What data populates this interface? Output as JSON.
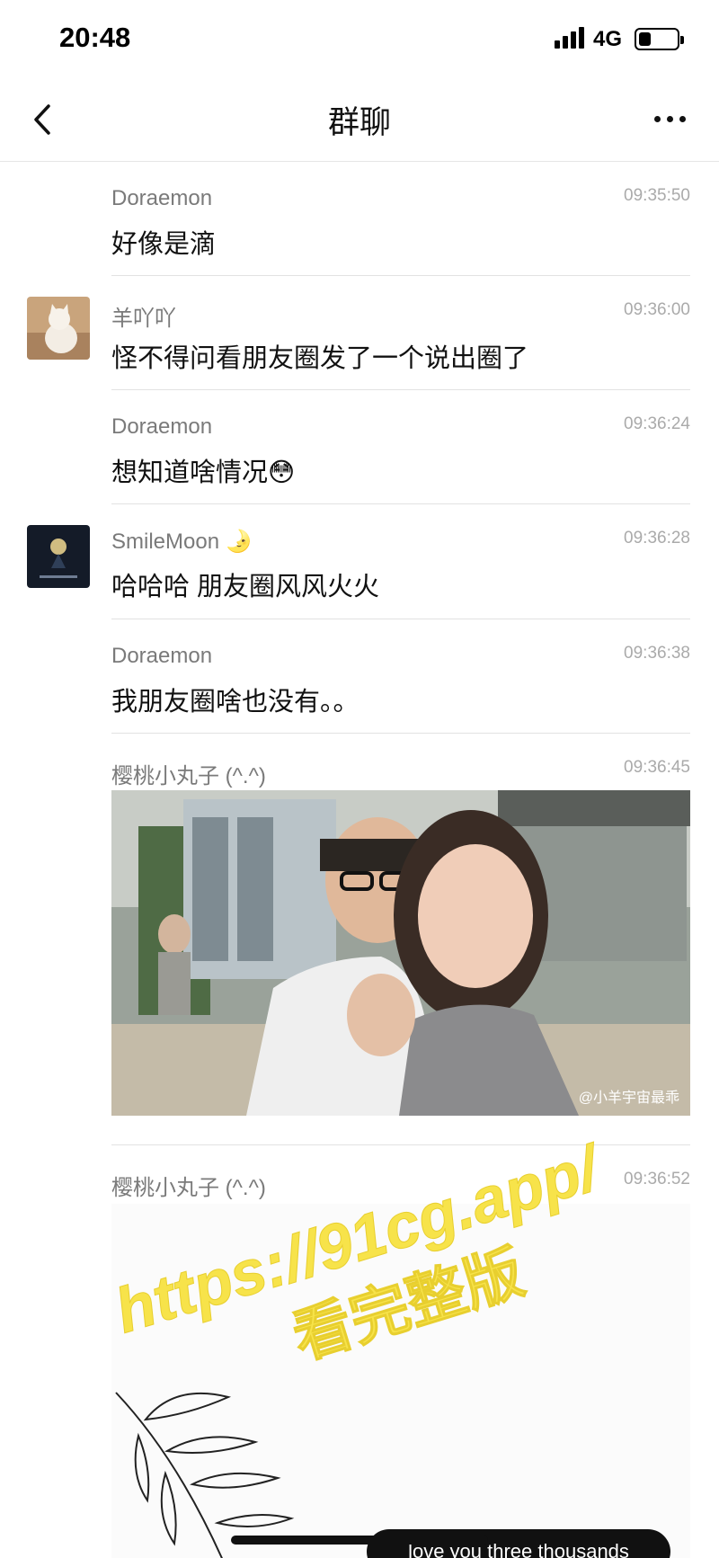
{
  "status_bar": {
    "time": "20:48",
    "network": "4G",
    "battery_level": 0.3
  },
  "nav": {
    "title": "群聊"
  },
  "messages": [
    {
      "sender": "Doraemon",
      "time": "09:35:50",
      "text": "好像是滴"
    },
    {
      "sender": "羊吖吖",
      "time": "09:36:00",
      "text": "怪不得问看朋友圈发了一个说出圈了"
    },
    {
      "sender": "Doraemon",
      "time": "09:36:24",
      "text": "想知道啥情况😳"
    },
    {
      "sender": "SmileMoon 🌛",
      "time": "09:36:28",
      "text": "哈哈哈 朋友圈风风火火"
    },
    {
      "sender": "Doraemon",
      "time": "09:36:38",
      "text": "我朋友圈啥也没有。。"
    },
    {
      "sender": "樱桃小丸子 (^.^)",
      "time": "09:36:45",
      "image_watermark": "@小羊宇宙最乖"
    },
    {
      "sender": "樱桃小丸子 (^.^)",
      "time": "09:36:52",
      "image_caption": "love you three thousands"
    }
  ],
  "watermark": {
    "line1": "https://91cg.app/",
    "line2": "看完整版",
    "color": "#f7e34a"
  }
}
